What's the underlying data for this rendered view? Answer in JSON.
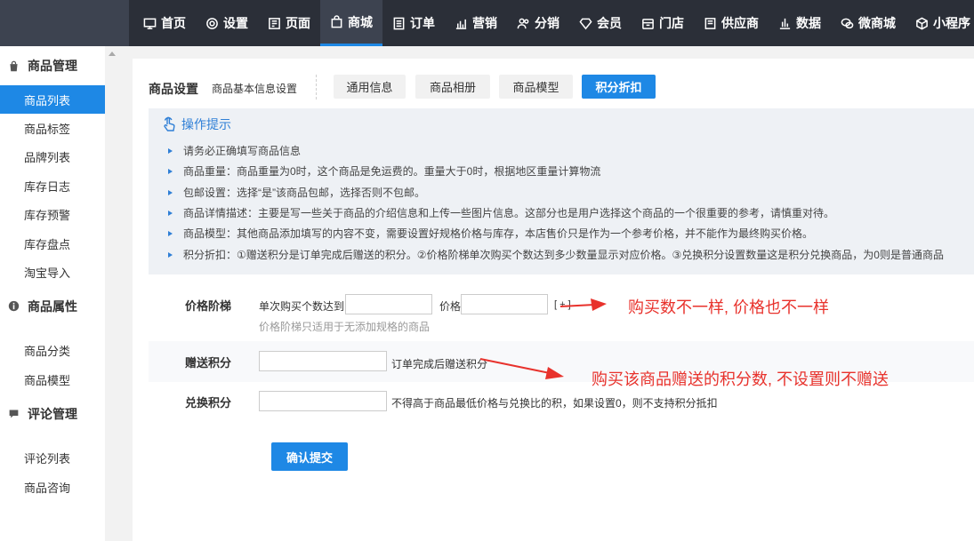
{
  "topnav": [
    {
      "label": "首页",
      "icon": "monitor-icon"
    },
    {
      "label": "设置",
      "icon": "gear-icon"
    },
    {
      "label": "页面",
      "icon": "page-icon"
    },
    {
      "label": "商城",
      "icon": "bag-icon",
      "active": true
    },
    {
      "label": "订单",
      "icon": "list-icon"
    },
    {
      "label": "营销",
      "icon": "chart-icon"
    },
    {
      "label": "分销",
      "icon": "users-icon"
    },
    {
      "label": "会员",
      "icon": "diamond-icon"
    },
    {
      "label": "门店",
      "icon": "store-icon"
    },
    {
      "label": "供应商",
      "icon": "truck-icon"
    },
    {
      "label": "数据",
      "icon": "bar-icon"
    },
    {
      "label": "微商城",
      "icon": "wechat-icon"
    },
    {
      "label": "小程序",
      "icon": "cube-icon"
    }
  ],
  "sidebar": {
    "groups": [
      {
        "title": "商品管理",
        "icon": "bag-icon",
        "items": [
          "商品列表",
          "商品标签",
          "品牌列表",
          "库存日志",
          "库存预警",
          "库存盘点",
          "淘宝导入"
        ]
      },
      {
        "title": "商品属性",
        "icon": "info-icon",
        "items": [
          "商品分类",
          "商品模型"
        ]
      },
      {
        "title": "评论管理",
        "icon": "comment-icon",
        "items": [
          "评论列表",
          "商品咨询"
        ]
      }
    ]
  },
  "header": {
    "title": "商品设置",
    "subtitle": "商品基本信息设置",
    "tabs": [
      "通用信息",
      "商品相册",
      "商品模型",
      "积分折扣"
    ]
  },
  "tips": {
    "title": "操作提示",
    "items": [
      "请务必正确填写商品信息",
      "商品重量：商品重量为0时，这个商品是免运费的。重量大于0时，根据地区重量计算物流",
      "包邮设置：选择“是”该商品包邮，选择否则不包邮。",
      "商品详情描述：主要是写一些关于商品的介绍信息和上传一些图片信息。这部分也是用户选择这个商品的一个很重要的参考，请慎重对待。",
      "商品模型：其他商品添加填写的内容不变，需要设置好规格价格与库存，本店售价只是作为一个参考价格，并不能作为最终购买价格。",
      "积分折扣：①赠送积分是订单完成后赠送的积分。②价格阶梯单次购买个数达到多少数量显示对应价格。③兑换积分设置数量这是积分兑换商品，为0则是普通商品"
    ]
  },
  "form": {
    "price_tier": {
      "label": "价格阶梯",
      "qty_prefix": "单次购买个数达到",
      "price_prefix": "价格",
      "add_btn": "[ + ]",
      "hint": "价格阶梯只适用于无添加规格的商品",
      "qty_value": "",
      "price_value": ""
    },
    "gift_points": {
      "label": "赠送积分",
      "value": "",
      "suffix": "订单完成后赠送积分"
    },
    "exchange_points": {
      "label": "兑换积分",
      "value": "",
      "suffix": "不得高于商品最低价格与兑换比的积，如果设置0，则不支持积分抵扣"
    },
    "submit": "确认提交"
  },
  "annotations": {
    "price_note": "购买数不一样, 价格也不一样",
    "points_note": "购买该商品赠送的积分数, 不设置则不赠送",
    "color": "#e8322c"
  },
  "colors": {
    "accent": "#1e88e5",
    "topbar": "#2b2f38"
  }
}
